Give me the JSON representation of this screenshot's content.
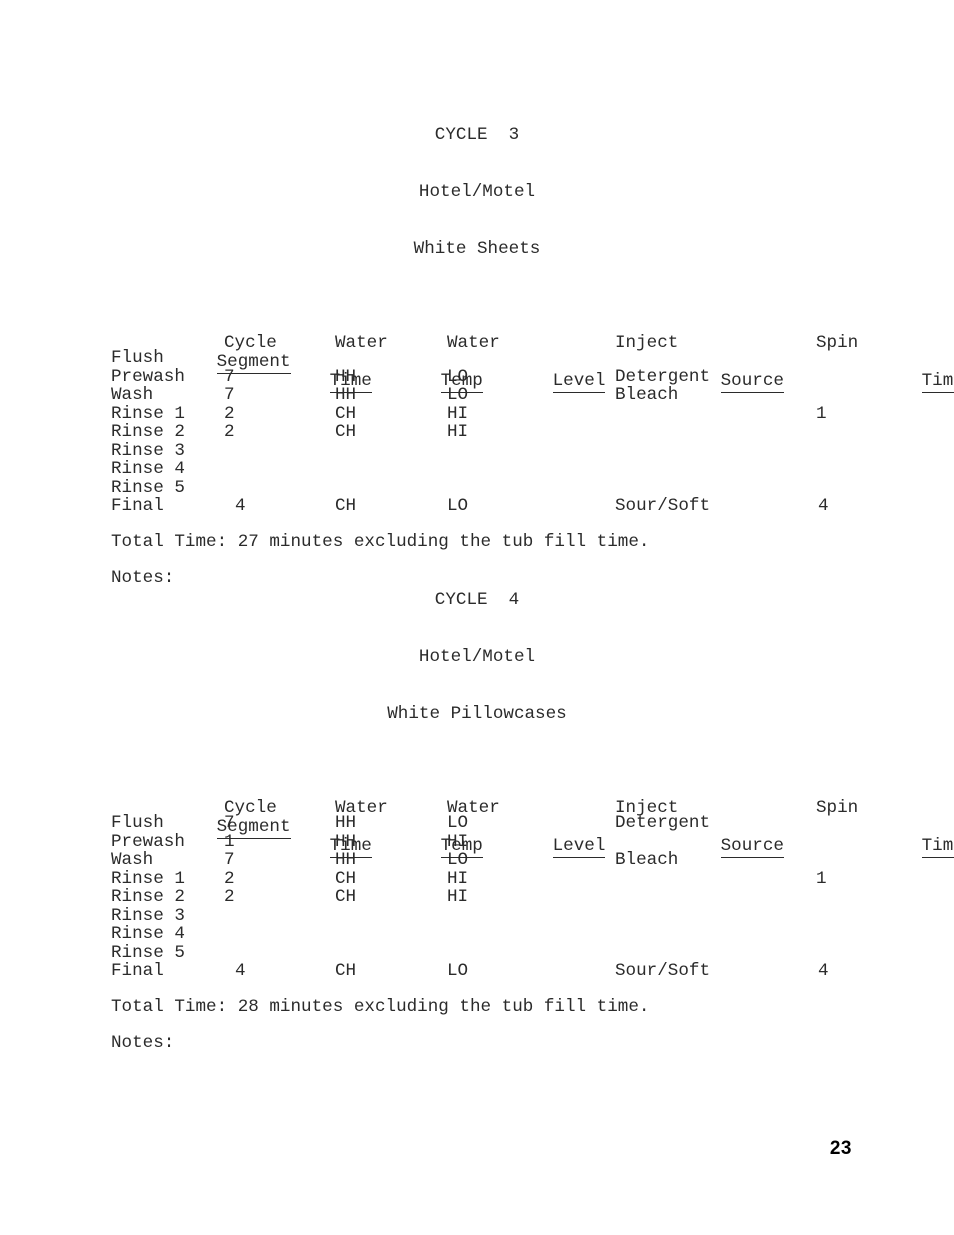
{
  "document": {
    "page_number": "23"
  },
  "columns": {
    "segment": {
      "line1": "",
      "line2": "Segment"
    },
    "cycle_time": {
      "line1": "Cycle",
      "line2": "Time"
    },
    "water_temp": {
      "line1": "Water",
      "line2": "Temp"
    },
    "water_level": {
      "line1": "Water",
      "line2": "Level"
    },
    "inject_source": {
      "line1": "Inject",
      "line2": "Source"
    },
    "spin_time": {
      "line1": "Spin",
      "line2": "Time"
    }
  },
  "cycles": [
    {
      "title": "CYCLE  3",
      "subtitle": "Hotel/Motel",
      "subject": "White Sheets",
      "rows": [
        {
          "segment": "Flush",
          "cycle_time": "",
          "water_temp": "",
          "water_level": "",
          "inject_source": "",
          "spin_time": ""
        },
        {
          "segment": "Prewash",
          "cycle_time": "7",
          "water_temp": "HH",
          "water_level": "LO",
          "inject_source": "Detergent",
          "spin_time": ""
        },
        {
          "segment": "Wash",
          "cycle_time": "7",
          "water_temp": "HH",
          "water_level": "LO",
          "inject_source": "Bleach",
          "spin_time": ""
        },
        {
          "segment": "Rinse 1",
          "cycle_time": "2",
          "water_temp": "CH",
          "water_level": "HI",
          "inject_source": "",
          "spin_time": "1"
        },
        {
          "segment": "Rinse 2",
          "cycle_time": "2",
          "water_temp": "CH",
          "water_level": "HI",
          "inject_source": "",
          "spin_time": ""
        },
        {
          "segment": "Rinse 3",
          "cycle_time": "",
          "water_temp": "",
          "water_level": "",
          "inject_source": "",
          "spin_time": ""
        },
        {
          "segment": "Rinse 4",
          "cycle_time": "",
          "water_temp": "",
          "water_level": "",
          "inject_source": "",
          "spin_time": ""
        },
        {
          "segment": "Rinse 5",
          "cycle_time": "",
          "water_temp": "",
          "water_level": "",
          "inject_source": "",
          "spin_time": ""
        },
        {
          "segment": "Final",
          "cycle_time": "4",
          "water_temp": "CH",
          "water_level": "LO",
          "inject_source": "Sour/Soft",
          "spin_time": "4"
        }
      ],
      "total_time": "Total Time: 27 minutes excluding the tub fill time.",
      "notes_label": "Notes:",
      "notes_value": ""
    },
    {
      "title": "CYCLE  4",
      "subtitle": "Hotel/Motel",
      "subject": "White Pillowcases",
      "rows": [
        {
          "segment": "Flush",
          "cycle_time": "7",
          "water_temp": "HH",
          "water_level": "LO",
          "inject_source": "Detergent",
          "spin_time": ""
        },
        {
          "segment": "Prewash",
          "cycle_time": "1",
          "water_temp": "HH",
          "water_level": "HI",
          "inject_source": "",
          "spin_time": ""
        },
        {
          "segment": "Wash",
          "cycle_time": "7",
          "water_temp": "HH",
          "water_level": "LO",
          "inject_source": "Bleach",
          "spin_time": ""
        },
        {
          "segment": "Rinse 1",
          "cycle_time": "2",
          "water_temp": "CH",
          "water_level": "HI",
          "inject_source": "",
          "spin_time": "1"
        },
        {
          "segment": "Rinse 2",
          "cycle_time": "2",
          "water_temp": "CH",
          "water_level": "HI",
          "inject_source": "",
          "spin_time": ""
        },
        {
          "segment": "Rinse 3",
          "cycle_time": "",
          "water_temp": "",
          "water_level": "",
          "inject_source": "",
          "spin_time": ""
        },
        {
          "segment": "Rinse 4",
          "cycle_time": "",
          "water_temp": "",
          "water_level": "",
          "inject_source": "",
          "spin_time": ""
        },
        {
          "segment": "Rinse 5",
          "cycle_time": "",
          "water_temp": "",
          "water_level": "",
          "inject_source": "",
          "spin_time": ""
        },
        {
          "segment": "Final",
          "cycle_time": "4",
          "water_temp": "CH",
          "water_level": "LO",
          "inject_source": "Sour/Soft",
          "spin_time": "4"
        }
      ],
      "total_time": "Total Time: 28 minutes excluding the tub fill time.",
      "notes_label": "Notes:",
      "notes_value": ""
    }
  ],
  "layout": {
    "block_tops": [
      88,
      553
    ]
  }
}
